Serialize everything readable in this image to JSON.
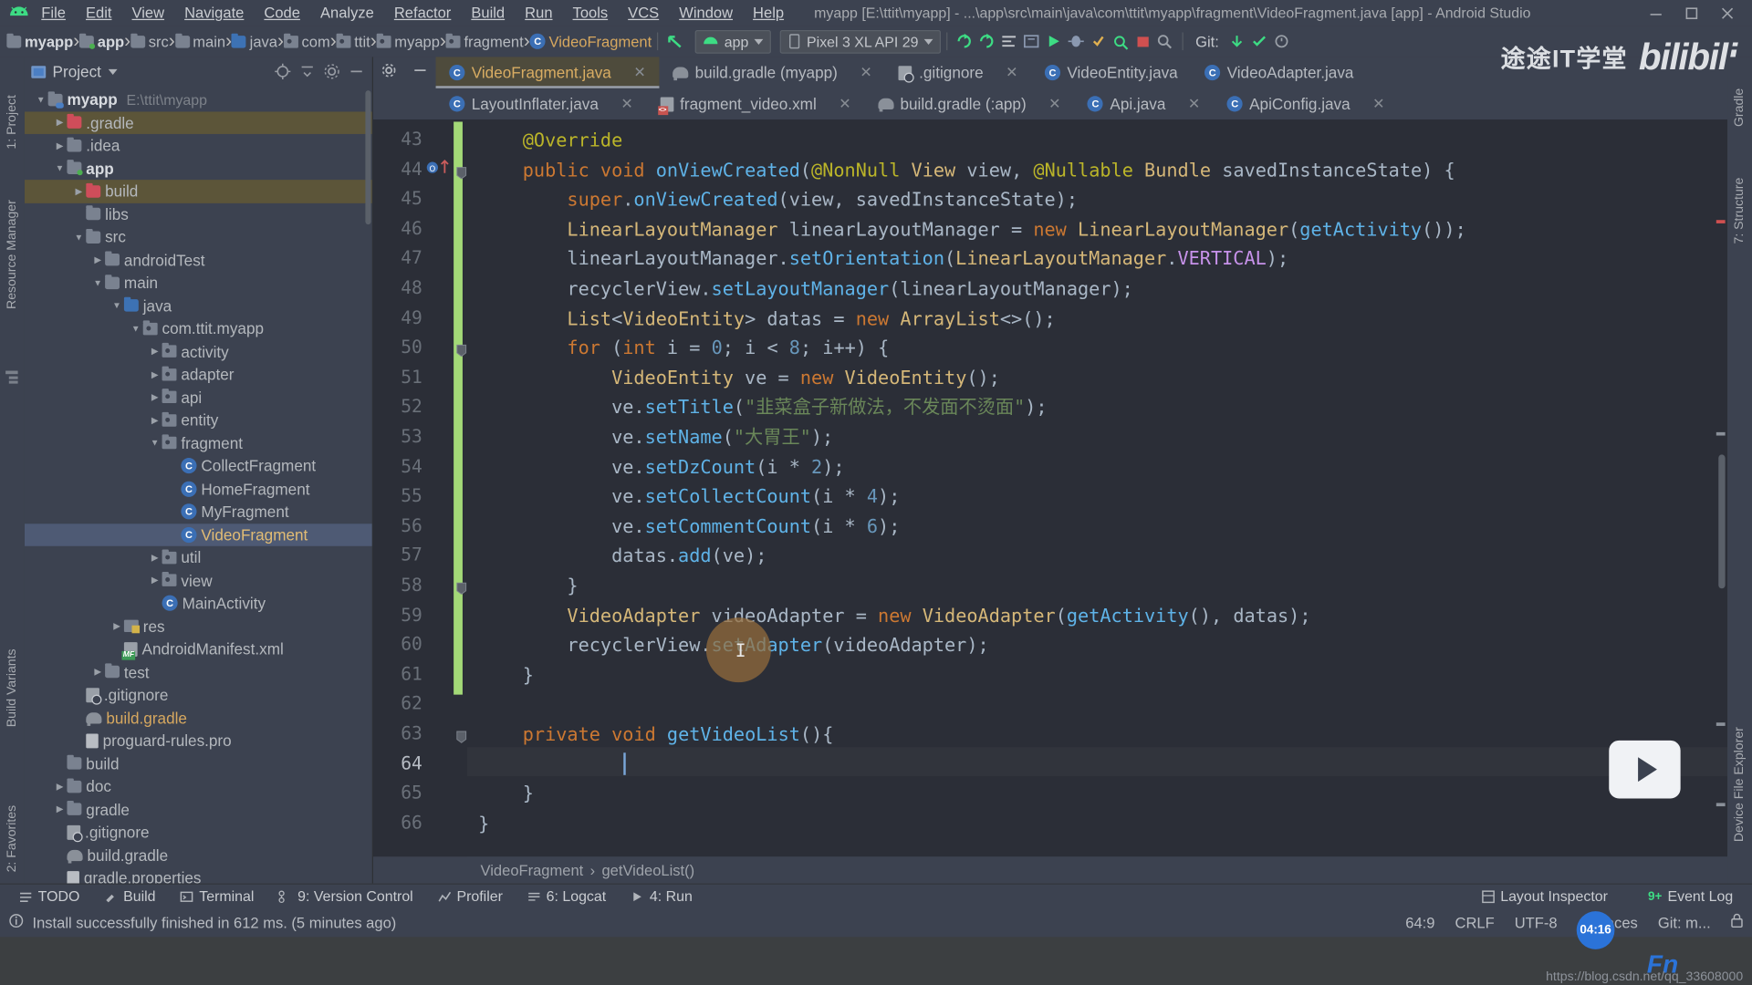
{
  "window": {
    "title": "myapp [E:\\ttit\\myapp] - ...\\app\\src\\main\\java\\com\\ttit\\myapp\\fragment\\VideoFragment.java [app] - Android Studio",
    "minimize": "minimize-icon",
    "maximize": "maximize-icon",
    "close": "close-icon"
  },
  "menu": {
    "items": [
      "File",
      "Edit",
      "View",
      "Navigate",
      "Code",
      "Analyze",
      "Refactor",
      "Build",
      "Run",
      "Tools",
      "VCS",
      "Window",
      "Help"
    ]
  },
  "watermark": {
    "cn": "途途IT学堂",
    "brand": "bilibili",
    "url": "https://blog.csdn.net/qq_33608000"
  },
  "breadcrumb": {
    "items": [
      {
        "label": "myapp",
        "icon": "module-icon",
        "bold": true
      },
      {
        "label": "app",
        "icon": "module-green-icon",
        "bold": true
      },
      {
        "label": "src",
        "icon": "folder-icon"
      },
      {
        "label": "main",
        "icon": "folder-icon"
      },
      {
        "label": "java",
        "icon": "folder-blue-icon"
      },
      {
        "label": "com",
        "icon": "package-icon"
      },
      {
        "label": "ttit",
        "icon": "package-icon"
      },
      {
        "label": "myapp",
        "icon": "package-icon"
      },
      {
        "label": "fragment",
        "icon": "package-icon"
      },
      {
        "label": "VideoFragment",
        "icon": "class-icon"
      }
    ],
    "separator": "›"
  },
  "toolbar": {
    "run_config": "app",
    "device": "Pixel 3 XL API 29",
    "git_label": "Git:",
    "icons": [
      "back-arrow-icon",
      "run-icon",
      "debug-icon",
      "profile-icon",
      "apply-changes-icon",
      "attach-debugger-icon",
      "sdk-manager-icon",
      "avd-manager-icon",
      "sync-gradle-icon",
      "avd-icon",
      "search-icon",
      "stop-icon",
      "git-update-icon",
      "git-commit-icon",
      "git-history-icon"
    ]
  },
  "project_panel": {
    "title": "Project",
    "header_icons": [
      "locate-icon",
      "collapse-all-icon",
      "settings-gear-icon",
      "hide-icon"
    ],
    "tree": [
      {
        "label": "myapp",
        "path": "E:\\ttit\\myapp",
        "depth": 0,
        "arrow": "down",
        "icon": "module-icon",
        "bold": true
      },
      {
        "label": ".gradle",
        "depth": 1,
        "arrow": "right",
        "icon": "folder-red-icon",
        "excluded": true
      },
      {
        "label": ".idea",
        "depth": 1,
        "arrow": "right",
        "icon": "folder-icon"
      },
      {
        "label": "app",
        "depth": 1,
        "arrow": "down",
        "icon": "module-green-icon",
        "bold": true
      },
      {
        "label": "build",
        "depth": 2,
        "arrow": "right",
        "icon": "folder-red-icon",
        "excluded": true
      },
      {
        "label": "libs",
        "depth": 2,
        "arrow": "none",
        "icon": "folder-icon"
      },
      {
        "label": "src",
        "depth": 2,
        "arrow": "down",
        "icon": "folder-icon"
      },
      {
        "label": "androidTest",
        "depth": 3,
        "arrow": "right",
        "icon": "folder-icon"
      },
      {
        "label": "main",
        "depth": 3,
        "arrow": "down",
        "icon": "folder-icon"
      },
      {
        "label": "java",
        "depth": 4,
        "arrow": "down",
        "icon": "folder-blue-icon"
      },
      {
        "label": "com.ttit.myapp",
        "depth": 5,
        "arrow": "down",
        "icon": "package-icon"
      },
      {
        "label": "activity",
        "depth": 6,
        "arrow": "right",
        "icon": "package-icon"
      },
      {
        "label": "adapter",
        "depth": 6,
        "arrow": "right",
        "icon": "package-icon"
      },
      {
        "label": "api",
        "depth": 6,
        "arrow": "right",
        "icon": "package-icon"
      },
      {
        "label": "entity",
        "depth": 6,
        "arrow": "right",
        "icon": "package-icon"
      },
      {
        "label": "fragment",
        "depth": 6,
        "arrow": "down",
        "icon": "package-icon"
      },
      {
        "label": "CollectFragment",
        "depth": 7,
        "arrow": "none",
        "icon": "class-icon"
      },
      {
        "label": "HomeFragment",
        "depth": 7,
        "arrow": "none",
        "icon": "class-icon"
      },
      {
        "label": "MyFragment",
        "depth": 7,
        "arrow": "none",
        "icon": "class-icon"
      },
      {
        "label": "VideoFragment",
        "depth": 7,
        "arrow": "none",
        "icon": "class-icon",
        "selected": true
      },
      {
        "label": "util",
        "depth": 6,
        "arrow": "right",
        "icon": "package-icon"
      },
      {
        "label": "view",
        "depth": 6,
        "arrow": "right",
        "icon": "package-icon"
      },
      {
        "label": "MainActivity",
        "depth": 6,
        "arrow": "none",
        "icon": "class-icon"
      },
      {
        "label": "res",
        "depth": 4,
        "arrow": "right",
        "icon": "res-folder-icon"
      },
      {
        "label": "AndroidManifest.xml",
        "depth": 4,
        "arrow": "none",
        "icon": "manifest-icon"
      },
      {
        "label": "test",
        "depth": 3,
        "arrow": "right",
        "icon": "folder-icon"
      },
      {
        "label": ".gitignore",
        "depth": 2,
        "arrow": "none",
        "icon": "gitignore-icon"
      },
      {
        "label": "build.gradle",
        "depth": 2,
        "arrow": "none",
        "icon": "gradle-icon",
        "orange": true
      },
      {
        "label": "proguard-rules.pro",
        "depth": 2,
        "arrow": "none",
        "icon": "pro-file-icon"
      },
      {
        "label": "build",
        "depth": 1,
        "arrow": "none",
        "icon": "folder-icon"
      },
      {
        "label": "doc",
        "depth": 1,
        "arrow": "right",
        "icon": "folder-icon"
      },
      {
        "label": "gradle",
        "depth": 1,
        "arrow": "right",
        "icon": "folder-icon"
      },
      {
        "label": ".gitignore",
        "depth": 1,
        "arrow": "none",
        "icon": "gitignore-icon"
      },
      {
        "label": "build.gradle",
        "depth": 1,
        "arrow": "none",
        "icon": "gradle-icon"
      },
      {
        "label": "gradle.properties",
        "depth": 1,
        "arrow": "none",
        "icon": "properties-icon"
      }
    ]
  },
  "editor_tabs": {
    "row1": [
      {
        "label": "VideoFragment.java",
        "icon": "class-icon",
        "active": true,
        "closeable": true
      },
      {
        "label": "build.gradle (myapp)",
        "icon": "gradle-icon",
        "closeable": true
      },
      {
        "label": ".gitignore",
        "icon": "gitignore-icon",
        "closeable": true
      },
      {
        "label": "VideoEntity.java",
        "icon": "class-icon",
        "closeable": false
      },
      {
        "label": "VideoAdapter.java",
        "icon": "class-icon",
        "closeable": false
      }
    ],
    "row2": [
      {
        "label": "LayoutInflater.java",
        "icon": "class-icon",
        "closeable": true
      },
      {
        "label": "fragment_video.xml",
        "icon": "xml-icon",
        "closeable": true
      },
      {
        "label": "build.gradle (:app)",
        "icon": "gradle-icon",
        "closeable": true
      },
      {
        "label": "Api.java",
        "icon": "class-icon",
        "closeable": true
      },
      {
        "label": "ApiConfig.java",
        "icon": "class-icon",
        "closeable": true
      }
    ]
  },
  "code": {
    "first_line": 43,
    "current_line": 64,
    "lines": [
      {
        "n": 43,
        "html": "    <span class='ann'>@Override</span>"
      },
      {
        "n": 44,
        "html": "    <span class='orng'>public</span> <span class='orng'>void</span> <span class='mth'>onViewCreated</span><span class='pun'>(</span><span class='ann'>@NonNull</span> <span class='typ'>View</span> <span class='var'>view</span><span class='pun'>,</span> <span class='ann'>@Nullable</span> <span class='typ'>Bundle</span> <span class='var'>savedInstanceState</span><span class='pun'>)</span> <span class='pun'>{</span>"
      },
      {
        "n": 45,
        "html": "        <span class='orng'>super</span><span class='pun'>.</span><span class='mth'>onViewCreated</span><span class='pun'>(</span><span class='var'>view</span><span class='pun'>,</span> <span class='var'>savedInstanceState</span><span class='pun'>);</span>"
      },
      {
        "n": 46,
        "html": "        <span class='typ'>LinearLayoutManager</span> <span class='var'>linearLayoutManager</span> <span class='pun'>=</span> <span class='orng'>new</span> <span class='typ'>LinearLayoutManager</span><span class='pun'>(</span><span class='mth'>getActivity</span><span class='pun'>());</span>"
      },
      {
        "n": 47,
        "html": "        <span class='var'>linearLayoutManager</span><span class='pun'>.</span><span class='mth'>setOrientation</span><span class='pun'>(</span><span class='typ'>LinearLayoutManager</span><span class='pun'>.</span><span class='vio'>VERTICAL</span><span class='pun'>);</span>"
      },
      {
        "n": 48,
        "html": "        <span class='var'>recyclerView</span><span class='pun'>.</span><span class='mth'>setLayoutManager</span><span class='pun'>(</span><span class='var'>linearLayoutManager</span><span class='pun'>);</span>"
      },
      {
        "n": 49,
        "html": "        <span class='typ'>List</span><span class='pun'>&lt;</span><span class='typ'>VideoEntity</span><span class='pun'>&gt;</span> <span class='var'>datas</span> <span class='pun'>=</span> <span class='orng'>new</span> <span class='typ'>ArrayList</span><span class='pun'>&lt;&gt;();</span>"
      },
      {
        "n": 50,
        "html": "        <span class='orng'>for</span> <span class='pun'>(</span><span class='orng'>int</span> <span class='var'>i</span> <span class='pun'>=</span> <span class='num'>0</span><span class='pun'>;</span> <span class='var'>i</span> <span class='pun'>&lt;</span> <span class='num'>8</span><span class='pun'>;</span> <span class='var'>i</span><span class='pun'>++)</span> <span class='pun'>{</span>"
      },
      {
        "n": 51,
        "html": "            <span class='typ'>VideoEntity</span> <span class='var'>ve</span> <span class='pun'>=</span> <span class='orng'>new</span> <span class='typ'>VideoEntity</span><span class='pun'>();</span>"
      },
      {
        "n": 52,
        "html": "            <span class='var'>ve</span><span class='pun'>.</span><span class='mth'>setTitle</span><span class='pun'>(</span><span class='str'>\"韭菜盒子新做法，不发面不烫面\"</span><span class='pun'>);</span>"
      },
      {
        "n": 53,
        "html": "            <span class='var'>ve</span><span class='pun'>.</span><span class='mth'>setName</span><span class='pun'>(</span><span class='str'>\"大胃王\"</span><span class='pun'>);</span>"
      },
      {
        "n": 54,
        "html": "            <span class='var'>ve</span><span class='pun'>.</span><span class='mth'>setDzCount</span><span class='pun'>(</span><span class='var'>i</span> <span class='pun'>*</span> <span class='num'>2</span><span class='pun'>);</span>"
      },
      {
        "n": 55,
        "html": "            <span class='var'>ve</span><span class='pun'>.</span><span class='mth'>setCollectCount</span><span class='pun'>(</span><span class='var'>i</span> <span class='pun'>*</span> <span class='num'>4</span><span class='pun'>);</span>"
      },
      {
        "n": 56,
        "html": "            <span class='var'>ve</span><span class='pun'>.</span><span class='mth'>setCommentCount</span><span class='pun'>(</span><span class='var'>i</span> <span class='pun'>*</span> <span class='num'>6</span><span class='pun'>);</span>"
      },
      {
        "n": 57,
        "html": "            <span class='var'>datas</span><span class='pun'>.</span><span class='mth'>add</span><span class='pun'>(</span><span class='var'>ve</span><span class='pun'>);</span>"
      },
      {
        "n": 58,
        "html": "        <span class='pun'>}</span>"
      },
      {
        "n": 59,
        "html": "        <span class='typ'>VideoAdapter</span> <span class='var'>videoAdapter</span> <span class='pun'>=</span> <span class='orng'>new</span> <span class='typ'>VideoAdapter</span><span class='pun'>(</span><span class='mth'>getActivity</span><span class='pun'>(),</span> <span class='var'>datas</span><span class='pun'>);</span>"
      },
      {
        "n": 60,
        "html": "        <span class='var'>recyclerView</span><span class='pun'>.</span><span class='mth'>setAdapter</span><span class='pun'>(</span><span class='var'>videoAdapter</span><span class='pun'>);</span>"
      },
      {
        "n": 61,
        "html": "    <span class='pun'>}</span>"
      },
      {
        "n": 62,
        "html": ""
      },
      {
        "n": 63,
        "html": "    <span class='orng'>private</span> <span class='orng'>void</span> <span class='mth'>getVideoList</span><span class='pun'>(){</span>"
      },
      {
        "n": 64,
        "html": ""
      },
      {
        "n": 65,
        "html": "    <span class='pun'>}</span>"
      },
      {
        "n": 66,
        "html": "<span class='pun'>}</span>"
      }
    ]
  },
  "editor_breadcrumb": {
    "class": "VideoFragment",
    "method": "getVideoList()",
    "sep": "›"
  },
  "bottom_tools": {
    "left": [
      {
        "label": "TODO",
        "icon": "todo-icon"
      },
      {
        "label": "Build",
        "icon": "build-icon"
      },
      {
        "label": "Terminal",
        "icon": "terminal-icon"
      },
      {
        "label": "9: Version Control",
        "icon": "vcs-icon"
      },
      {
        "label": "Profiler",
        "icon": "profiler-icon"
      },
      {
        "label": "6: Logcat",
        "icon": "logcat-icon"
      },
      {
        "label": "4: Run",
        "icon": "run-icon"
      }
    ],
    "right": [
      {
        "label": "Layout Inspector",
        "icon": "layout-inspector-icon"
      },
      {
        "label": "Event Log",
        "icon": "event-log-icon",
        "badge": "9+"
      }
    ]
  },
  "status_bar": {
    "message": "Install successfully finished in 612 ms. (5 minutes ago)",
    "position": "64:9",
    "line_sep": "CRLF",
    "encoding": "UTF-8",
    "indent": "4 spaces",
    "branch": "Git: m...",
    "lock": "lock-icon"
  },
  "overlays": {
    "clock": "04:16",
    "ime": "Fn",
    "cursor_blob": "text-cursor"
  },
  "left_rail": [
    {
      "label": "1: Project",
      "icon": "project-icon"
    },
    {
      "label": "Resource Manager",
      "icon": "resource-icon"
    },
    {
      "label": "Build Variants",
      "icon": "variants-icon"
    },
    {
      "label": "2: Favorites",
      "icon": "favorites-icon"
    }
  ],
  "right_rail": [
    {
      "label": "Gradle",
      "icon": "gradle-icon"
    },
    {
      "label": "7: Structure",
      "icon": "structure-icon"
    },
    {
      "label": "Device File Explorer",
      "icon": "device-file-icon"
    }
  ]
}
